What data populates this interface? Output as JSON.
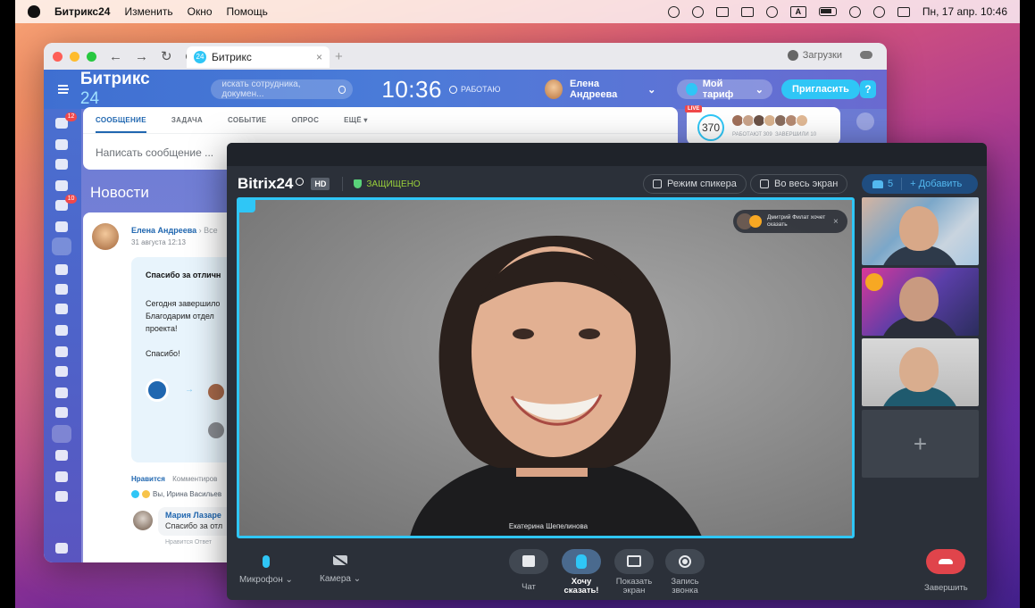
{
  "menubar": {
    "app_name": "Битрикс24",
    "menu_items": [
      "Изменить",
      "Окно",
      "Помощь"
    ],
    "keyboard_layout": "A",
    "datetime": "Пн, 17 апр. 10:46"
  },
  "browser": {
    "tab_title": "Битрикс",
    "tab_favicon": "24",
    "downloads_label": "Загрузки"
  },
  "portal": {
    "logo_text": "Битрикс",
    "logo_number": "24",
    "search_placeholder": "искать сотрудника, докумен...",
    "time": "10:36",
    "work_status": "РАБОТАЮ",
    "user_name": "Елена Андреева",
    "plan_label": "Мой тариф",
    "invite_label": "Пригласить",
    "help_label": "?",
    "rail_badges": [
      "12",
      "10"
    ],
    "composer_tabs": [
      "СООБЩЕНИЕ",
      "ЗАДАЧА",
      "СОБЫТИЕ",
      "ОПРОС",
      "ЕЩЁ"
    ],
    "composer_placeholder": "Написать сообщение ...",
    "live_label": "LIVE",
    "online_count": "370",
    "working_label": "РАБОТАЮТ 309",
    "finished_label": "ЗАВЕРШИЛИ 10",
    "news_title": "Новости",
    "post": {
      "author": "Елена Андреева",
      "target": "Все",
      "date": "31 августа 12:13",
      "title": "Спасибо за отличн",
      "body_lines": [
        "Сегодня завершило",
        "Благодарим отдел",
        "проекта!"
      ],
      "thanks": "Спасибо!",
      "like_label": "Нравится",
      "comment_label": "Комментиров",
      "reactions_text": "Вы, Ирина Васильев",
      "comment_author": "Мария Лазаре",
      "comment_text": "Спасибо за отл",
      "comment_meta": "Нравится   Ответ"
    }
  },
  "call": {
    "logo": "Bitrix24",
    "hd_label": "HD",
    "secure_label": "ЗАЩИЩЕНО",
    "speaker_mode_label": "Режим спикера",
    "fullscreen_label": "Во весь экран",
    "participants_count": "5",
    "add_label": "Добавить",
    "raise_hand_notice": "Дмитрий Филат хочет сказать",
    "main_speaker_name": "Екатерина Шепелинова",
    "thumbnails_plus": "+",
    "controls": {
      "mic": "Микрофон",
      "camera": "Камера",
      "chat": "Чат",
      "raise_hand": "Хочу сказать!",
      "screen_share": "Показать экран",
      "record": "Запись звонка",
      "hangup": "Завершить"
    }
  },
  "colors": {
    "accent": "#2fc6f6",
    "brand_blue": "#4a7bd8",
    "call_bg": "#2b3039",
    "hangup_red": "#e0444b",
    "secure_green": "#9ad13b"
  }
}
